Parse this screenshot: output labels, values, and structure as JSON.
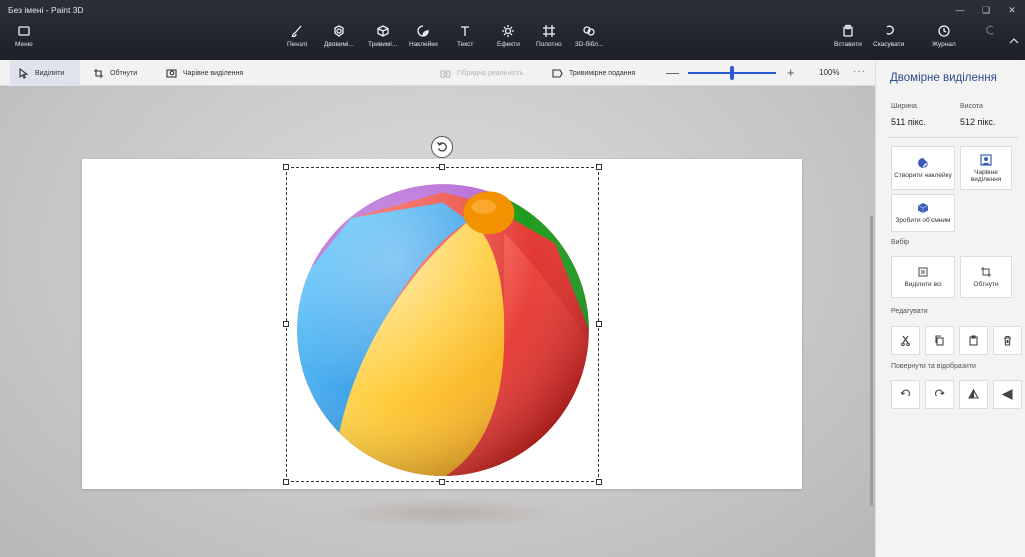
{
  "window": {
    "title": "Без імені - Paint 3D"
  },
  "ribbon": {
    "menu": "Меню",
    "tools": [
      "Пензлі",
      "Двовимі...",
      "Тривимі...",
      "Наклейки",
      "Текст",
      "Ефекти",
      "Полотно",
      "3D-бібл..."
    ],
    "paste": "Вставити",
    "undo": "Скасувати",
    "history": "Журнал"
  },
  "toolbar": {
    "select": "Виділити",
    "crop": "Обтнути",
    "magic_select": "Чарівне виділення",
    "mixed_reality": "Гібридна реальність",
    "view_3d": "Тривимірне подання",
    "zoom_minus": "—",
    "zoom_plus": "+",
    "zoom": "100%",
    "more": "···"
  },
  "panel": {
    "title": "Двомірне виділення",
    "width_label": "Ширина",
    "width_value": "511 пікс.",
    "height_label": "Висота",
    "height_value": "512 пікс.",
    "make_sticker": "Створити наклейку",
    "magic_select": "Чарівне виділення",
    "make_3d": "Зробити об'ємним",
    "selection_section": "Вибір",
    "select_all": "Виділити всі",
    "crop": "Обтнути",
    "edit_section": "Редагувати",
    "rotate_section": "Повернути та відобразити"
  },
  "canvas": {
    "selection_active": true
  }
}
